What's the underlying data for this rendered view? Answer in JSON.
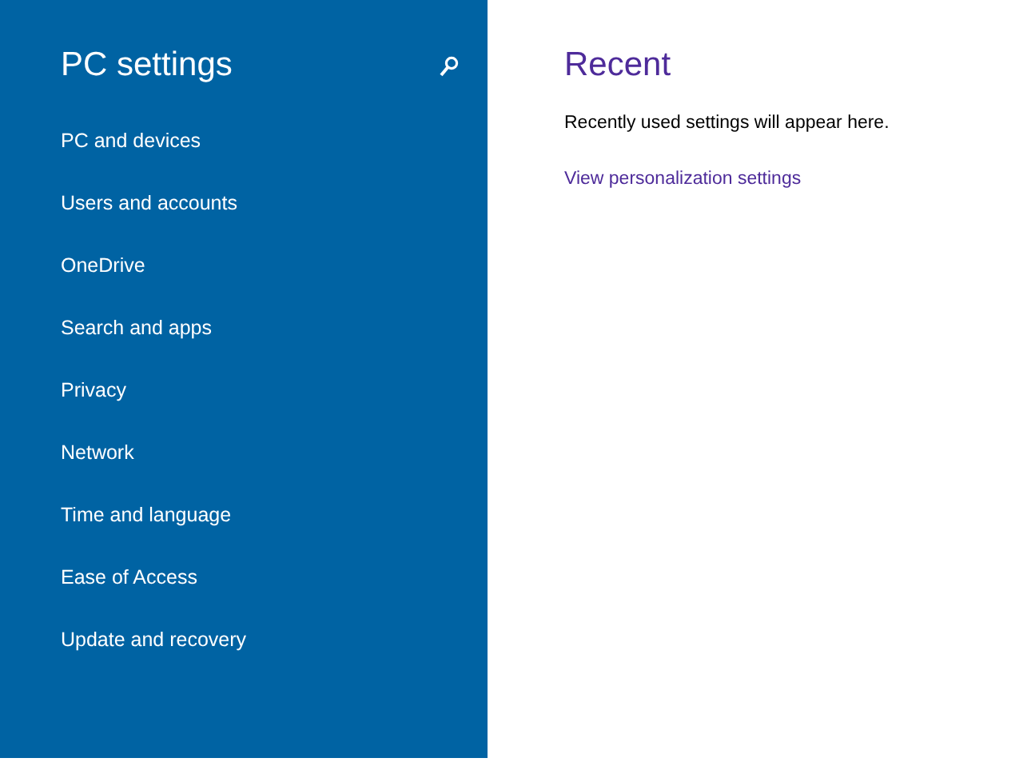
{
  "sidebar": {
    "title": "PC settings",
    "items": [
      {
        "label": "PC and devices"
      },
      {
        "label": "Users and accounts"
      },
      {
        "label": "OneDrive"
      },
      {
        "label": "Search and apps"
      },
      {
        "label": "Privacy"
      },
      {
        "label": "Network"
      },
      {
        "label": "Time and language"
      },
      {
        "label": "Ease of Access"
      },
      {
        "label": "Update and recovery"
      }
    ]
  },
  "main": {
    "title": "Recent",
    "message": "Recently used settings will appear here.",
    "link": "View personalization settings"
  }
}
